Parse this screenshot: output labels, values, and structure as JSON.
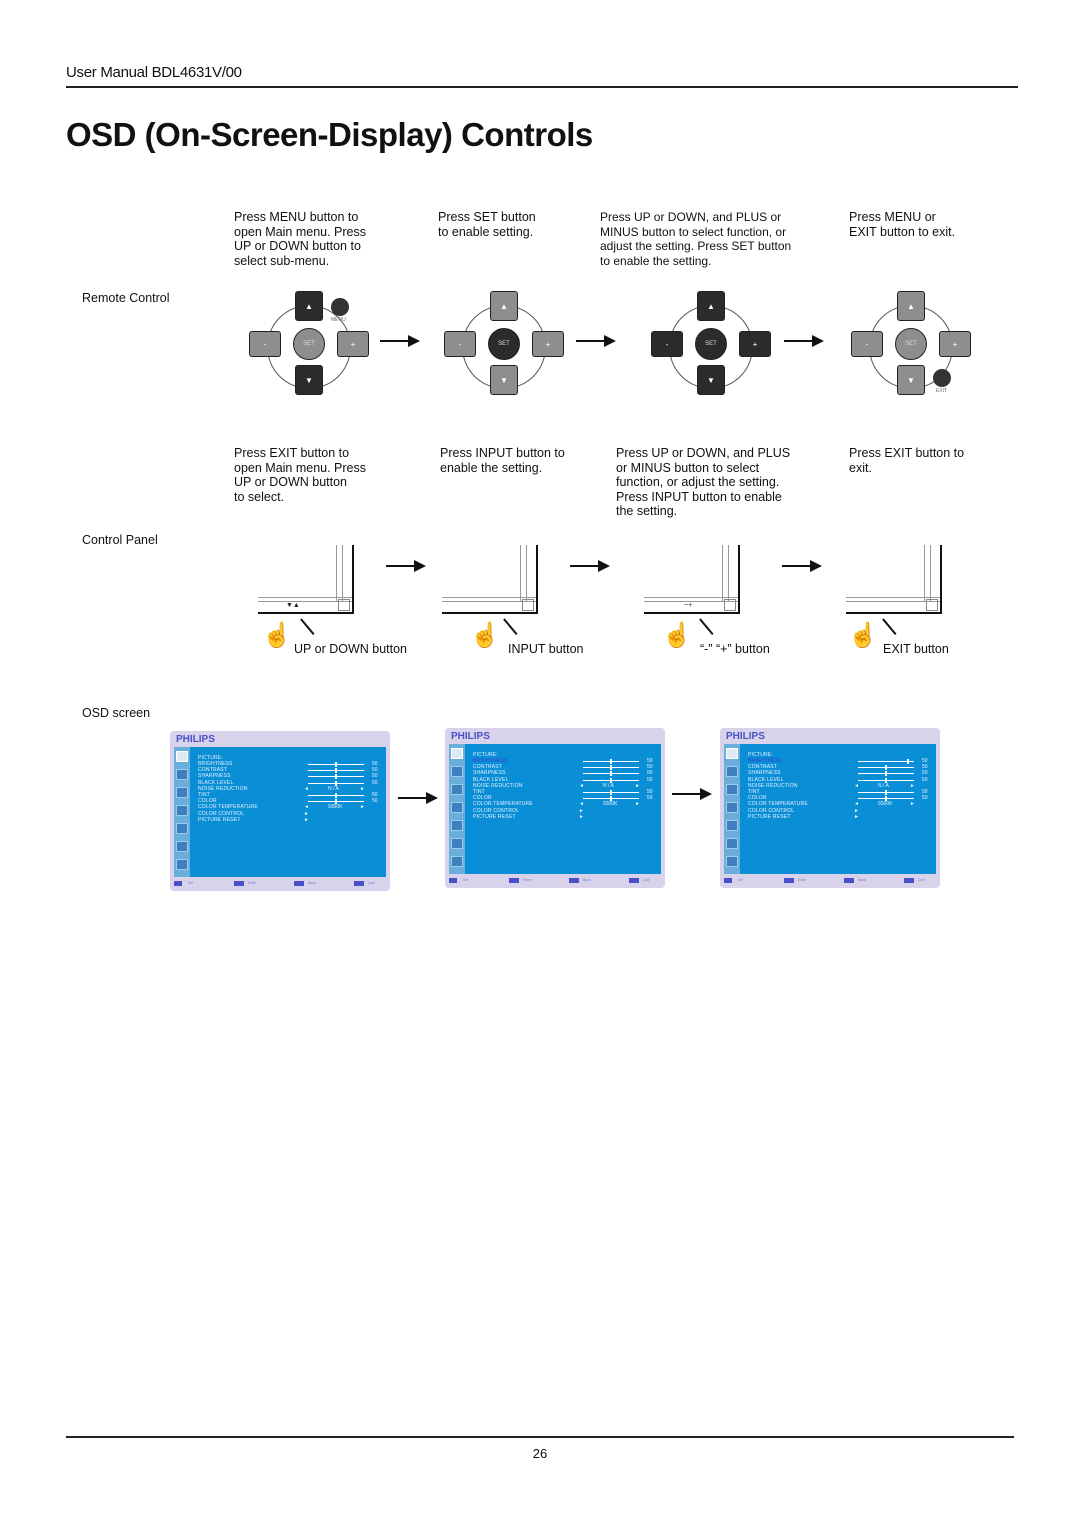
{
  "header": {
    "manual_title": "User Manual BDL4631V/00"
  },
  "page_title": "OSD (On-Screen-Display) Controls",
  "remote_control": {
    "label": "Remote Control",
    "steps": [
      {
        "text": "Press MENU button to\nopen Main menu.   Press\nUP or DOWN button to\nselect sub-menu.",
        "highlight": "arrows",
        "side_button": "MENU"
      },
      {
        "text": "Press SET button\nto enable setting.",
        "highlight": "set"
      },
      {
        "text": "Press UP or DOWN, and PLUS or\nMINUS button to select function, or\nadjust the setting. Press SET button\nto enable the setting.",
        "highlight": "all"
      },
      {
        "text": "Press MENU or\nEXIT button to exit.",
        "highlight": "none",
        "side_button": "EXIT"
      }
    ],
    "key_labels": {
      "minus": "-",
      "plus": "+",
      "set": "SET",
      "up": "▲",
      "down": "▼"
    }
  },
  "control_panel": {
    "label": "Control Panel",
    "steps": [
      {
        "text": "Press EXIT button to\nopen Main menu. Press\nUP or DOWN button\nto select.",
        "button_label": "UP or DOWN button",
        "bezel_mark": "▼▲"
      },
      {
        "text": "Press INPUT button to\nenable the setting.",
        "button_label": "INPUT button",
        "bezel_mark": ""
      },
      {
        "text": "Press UP or DOWN, and PLUS\nor MINUS button to select\nfunction, or adjust the setting.\nPress INPUT button to enable\nthe setting.",
        "button_label": "“-” “+” button",
        "bezel_mark": "−+"
      },
      {
        "text": "Press EXIT button to\nexit.",
        "button_label": "EXIT button",
        "bezel_mark": ""
      }
    ]
  },
  "osd_screen": {
    "label": "OSD screen",
    "brand": "PHILIPS",
    "menu_title": "PICTURE:",
    "items": [
      {
        "label": "BRIGHTNESS",
        "type": "slider",
        "value": "50"
      },
      {
        "label": "CONTRAST",
        "type": "slider",
        "value": "50"
      },
      {
        "label": "SHARPNESS",
        "type": "slider",
        "value": "50"
      },
      {
        "label": "BLACK  LEVEL",
        "type": "slider",
        "value": "50"
      },
      {
        "label": "NOISE  REDUCTION",
        "type": "select",
        "value": "N / A"
      },
      {
        "label": "TINT",
        "type": "slider",
        "value": "50"
      },
      {
        "label": "COLOR",
        "type": "slider",
        "value": "50"
      },
      {
        "label": "COLOR  TEMPERATURE",
        "type": "select",
        "value": "9300K"
      },
      {
        "label": "COLOR  CONTROL",
        "type": "submenu",
        "value": ""
      },
      {
        "label": "PICTURE  RESET",
        "type": "submenu",
        "value": ""
      }
    ],
    "screens": [
      {
        "highlight_row": -1,
        "brightness_level": 0.5
      },
      {
        "highlight_row": 0,
        "brightness_level": 0.5
      },
      {
        "highlight_row": 0,
        "brightness_level": 0.9
      }
    ],
    "bottom_bar": [
      "Sel",
      "Enter",
      "Back",
      "Quit"
    ],
    "colors": {
      "panel": "#0a8fd6",
      "frame": "#d8d3ea",
      "brand": "#4a50c8",
      "sidebar": "#6aaedc"
    }
  },
  "footer": {
    "page_number": "26"
  }
}
